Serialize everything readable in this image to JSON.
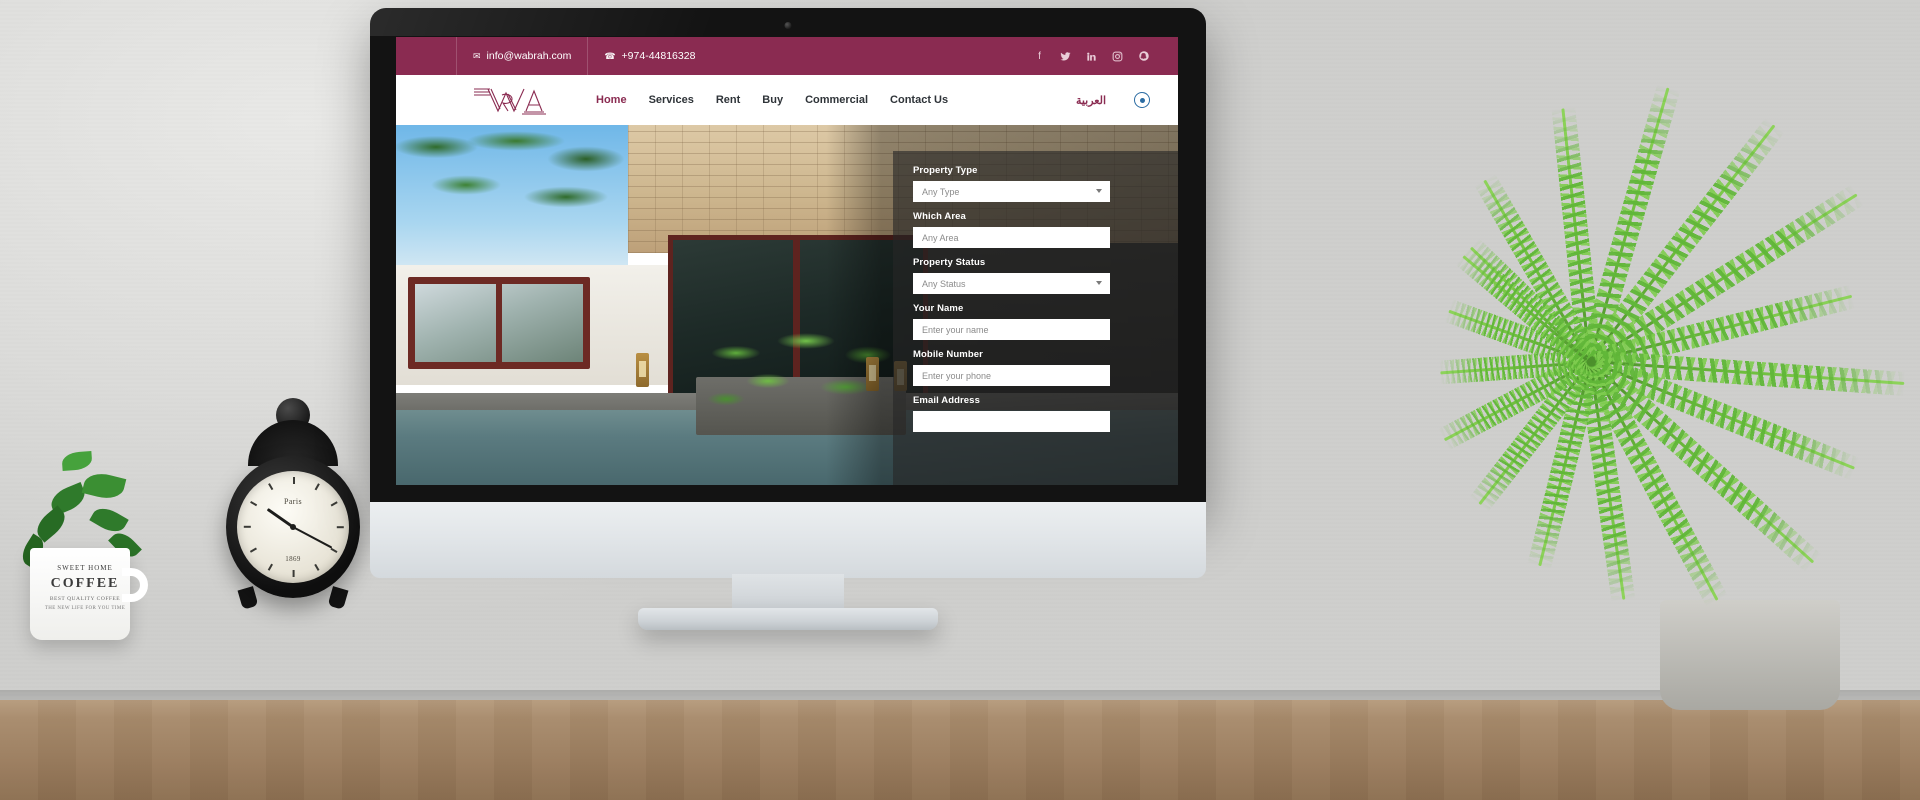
{
  "site": {
    "topbar": {
      "email": "info@wabrah.com",
      "email_icon": "envelope-icon",
      "phone": "+974-44816328",
      "phone_icon": "phone-icon",
      "socials": [
        {
          "name": "facebook-icon",
          "glyph": "f"
        },
        {
          "name": "twitter-icon",
          "glyph": "ᵗ"
        },
        {
          "name": "linkedin-icon",
          "glyph": "in"
        },
        {
          "name": "instagram-icon",
          "glyph": "▢"
        },
        {
          "name": "snapchat-icon",
          "glyph": "●"
        }
      ]
    },
    "navbar": {
      "logo_text": "WRA",
      "links": [
        {
          "label": "Home",
          "active": true
        },
        {
          "label": "Services",
          "active": false
        },
        {
          "label": "Rent",
          "active": false
        },
        {
          "label": "Buy",
          "active": false
        },
        {
          "label": "Commercial",
          "active": false
        },
        {
          "label": "Contact Us",
          "active": false
        }
      ],
      "language_toggle": "العربية",
      "account_icon": "user-account-icon"
    },
    "search_panel": {
      "fields": [
        {
          "label": "Property Type",
          "value": "Any Type",
          "control": "select"
        },
        {
          "label": "Which Area",
          "value": "Any Area",
          "control": "input"
        },
        {
          "label": "Property Status",
          "value": "Any Status",
          "control": "select"
        },
        {
          "label": "Your Name",
          "value": "Enter your name",
          "control": "input"
        },
        {
          "label": "Mobile Number",
          "value": "Enter your phone",
          "control": "input"
        },
        {
          "label": "Email Address",
          "value": "",
          "control": "input"
        }
      ]
    },
    "colors": {
      "brand_maroon": "#8a2b51",
      "nav_text": "#2f3439",
      "accent_blue": "#2b6ca3",
      "panel_overlay": "rgba(38,38,38,0.62)"
    }
  },
  "desk_objects": {
    "clock": {
      "name": "alarm-clock",
      "brand_label": "Paris",
      "year_label": "1869"
    },
    "mug": {
      "name": "coffee-mug-planter",
      "line1": "SWEET HOME",
      "line2": "COFFEE",
      "line3": "BEST QUALITY COFFEE",
      "line4": "THE NEW LIFE FOR YOU TIME"
    },
    "fern": {
      "name": "boston-fern-plant"
    }
  }
}
